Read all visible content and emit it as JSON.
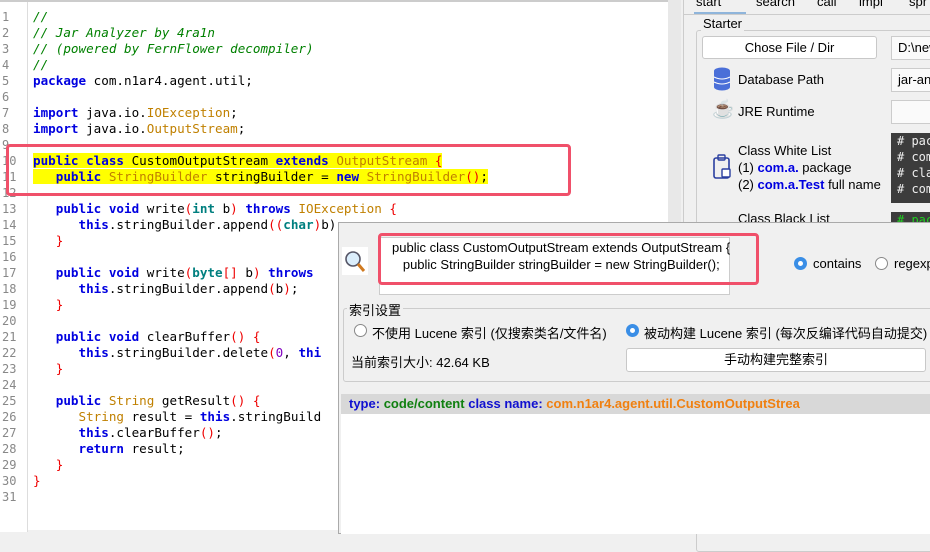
{
  "editor": {
    "lines": [
      [
        [
          "//",
          "cm"
        ]
      ],
      [
        [
          "// Jar Analyzer by 4ra1n",
          "cm"
        ]
      ],
      [
        [
          "// (powered by FernFlower decompiler)",
          "cm"
        ]
      ],
      [
        [
          "//",
          "cm"
        ]
      ],
      [
        [
          "package",
          "kw"
        ],
        [
          " com.n1ar4.agent.util;",
          "pl"
        ]
      ],
      [],
      [
        [
          "import",
          "kw"
        ],
        [
          " java.io.",
          "pl"
        ],
        [
          "IOException",
          "ty"
        ],
        [
          ";",
          "pl"
        ]
      ],
      [
        [
          "import",
          "kw"
        ],
        [
          " java.io.",
          "pl"
        ],
        [
          "OutputStream",
          "ty"
        ],
        [
          ";",
          "pl"
        ]
      ],
      [],
      [
        [
          "public class",
          "kw hl"
        ],
        [
          " CustomOutputStream ",
          "pl hl"
        ],
        [
          "extends",
          "kw hl"
        ],
        [
          " OutputStream ",
          "ty hl"
        ],
        [
          "{",
          "br hl"
        ]
      ],
      [
        [
          "   ",
          "hl"
        ],
        [
          "public",
          "kw hl"
        ],
        [
          " StringBuilder",
          "ty hl"
        ],
        [
          " stringBuilder = ",
          "pl hl"
        ],
        [
          "new",
          "kw hl"
        ],
        [
          " StringBuilder",
          "ty hl"
        ],
        [
          "()",
          "br hl"
        ],
        [
          ";",
          "pl hl"
        ]
      ],
      [],
      [
        [
          "   "
        ],
        [
          "public void",
          "kw"
        ],
        [
          " write",
          "pl"
        ],
        [
          "(",
          "br"
        ],
        [
          "int",
          "pr"
        ],
        [
          " b",
          "pl"
        ],
        [
          ")",
          "br"
        ],
        [
          " throws",
          "kw"
        ],
        [
          " IOException ",
          "ty"
        ],
        [
          "{",
          "br"
        ]
      ],
      [
        [
          "      "
        ],
        [
          "this",
          "kw"
        ],
        [
          ".stringBuilder.append",
          "pl"
        ],
        [
          "((",
          "br"
        ],
        [
          "char",
          "pr"
        ],
        [
          ")",
          "br"
        ],
        [
          "b);",
          "pl"
        ]
      ],
      [
        [
          "   "
        ],
        [
          "}",
          "br"
        ]
      ],
      [],
      [
        [
          "   "
        ],
        [
          "public void",
          "kw"
        ],
        [
          " write",
          "pl"
        ],
        [
          "(",
          "br"
        ],
        [
          "byte",
          "pr"
        ],
        [
          "[]",
          "br"
        ],
        [
          " b",
          "pl"
        ],
        [
          ")",
          "br"
        ],
        [
          " throws",
          "kw"
        ]
      ],
      [
        [
          "      "
        ],
        [
          "this",
          "kw"
        ],
        [
          ".stringBuilder.append",
          "pl"
        ],
        [
          "(",
          "br"
        ],
        [
          "b",
          "pl"
        ],
        [
          ")",
          "br"
        ],
        [
          ";",
          "pl"
        ]
      ],
      [
        [
          "   "
        ],
        [
          "}",
          "br"
        ]
      ],
      [],
      [
        [
          "   "
        ],
        [
          "public void",
          "kw"
        ],
        [
          " clearBuffer",
          "pl"
        ],
        [
          "()",
          "br"
        ],
        [
          " {",
          "br"
        ]
      ],
      [
        [
          "      "
        ],
        [
          "this",
          "kw"
        ],
        [
          ".stringBuilder.delete",
          "pl"
        ],
        [
          "(",
          "br"
        ],
        [
          "0",
          "nu"
        ],
        [
          ", ",
          "pl"
        ],
        [
          "thi",
          "kw"
        ]
      ],
      [
        [
          "   "
        ],
        [
          "}",
          "br"
        ]
      ],
      [],
      [
        [
          "   "
        ],
        [
          "public",
          "kw"
        ],
        [
          " String",
          "ty"
        ],
        [
          " getResult",
          "pl"
        ],
        [
          "()",
          "br"
        ],
        [
          " {",
          "br"
        ]
      ],
      [
        [
          "      "
        ],
        [
          "String",
          "ty"
        ],
        [
          " result = ",
          "pl"
        ],
        [
          "this",
          "kw"
        ],
        [
          ".stringBuild",
          "pl"
        ]
      ],
      [
        [
          "      "
        ],
        [
          "this",
          "kw"
        ],
        [
          ".clearBuffer",
          "pl"
        ],
        [
          "()",
          "br"
        ],
        [
          ";",
          "pl"
        ]
      ],
      [
        [
          "      "
        ],
        [
          "return",
          "kw"
        ],
        [
          " result;",
          "pl"
        ]
      ],
      [
        [
          "   "
        ],
        [
          "}",
          "br"
        ]
      ],
      [
        [
          "}",
          "br"
        ]
      ],
      []
    ]
  },
  "tabs": [
    "start",
    "search",
    "call",
    "impl",
    "spr"
  ],
  "starter": {
    "legend": "Starter",
    "chose_button": "Chose File / Dir",
    "chose_value": "D:\\new",
    "db_label": "Database Path",
    "db_value": "jar-an",
    "jre_label": "JRE Runtime",
    "jre_value": "",
    "white_title": "Class White List",
    "white_1_pre": "(1) ",
    "white_1_key": "com.a.",
    "white_1_post": " package",
    "white_2_pre": "(2) ",
    "white_2_key": "com.a.Test",
    "white_2_post": " full name",
    "white_text": "# pac\n# com\n# cla\n# com",
    "black_title": "Class Black List",
    "black_text": "# pac"
  },
  "popup": {
    "search_text_1": "public class CustomOutputStream extends OutputStream {",
    "search_text_2": "   public StringBuilder stringBuilder = new StringBuilder();",
    "contains": "contains",
    "regexp": "regexp",
    "index_legend": "索引设置",
    "no_lucene": "不使用 Lucene 索引 (仅搜索类名/文件名)",
    "passive_lucene": "被动构建 Lucene 索引 (每次反编译代码自动提交)",
    "index_size_label": "当前索引大小:",
    "index_size": "42.64 KB",
    "build_button": "手动构建完整索引",
    "result_type_label": "type:",
    "result_type": "code/content",
    "result_class_label": "class name:",
    "result_class": "com.n1ar4.agent.util.CustomOutputStrea"
  },
  "colors": {
    "highlight": "#ffff00",
    "annotation": "#f0506a",
    "accent": "#3a8ee6"
  }
}
